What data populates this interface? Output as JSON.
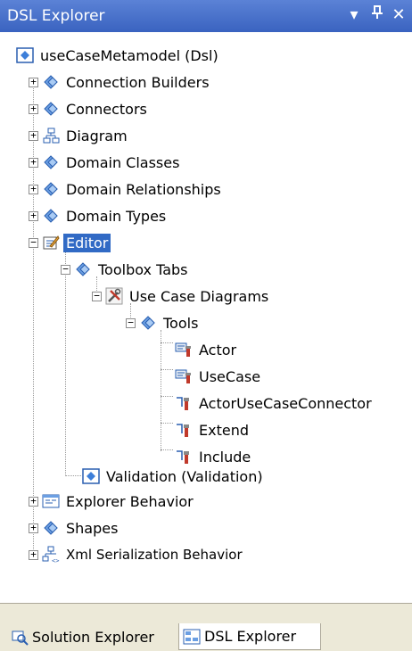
{
  "window": {
    "title": "DSL Explorer",
    "dropdown_glyph": "▾",
    "pin_glyph": "ᛡ",
    "close_glyph": "✕"
  },
  "tree": {
    "root": "useCaseMetamodel (Dsl)",
    "connection_builders": "Connection Builders",
    "connectors": "Connectors",
    "diagram": "Diagram",
    "domain_classes": "Domain Classes",
    "domain_relationships": "Domain Relationships",
    "domain_types": "Domain Types",
    "editor": "Editor",
    "toolbox_tabs": "Toolbox Tabs",
    "use_case_diagrams": "Use Case Diagrams",
    "tools": "Tools",
    "actor": "Actor",
    "usecase": "UseCase",
    "actor_usecase_connector": "ActorUseCaseConnector",
    "extend": "Extend",
    "include": "Include",
    "validation": "Validation (Validation)",
    "explorer_behavior": "Explorer Behavior",
    "shapes": "Shapes",
    "xml_serialization": "Xml Serialization Behavior"
  },
  "expander": {
    "plus": "+",
    "minus": "−"
  },
  "tabs": {
    "solution_explorer": "Solution Explorer",
    "dsl_explorer": "DSL Explorer"
  },
  "colors": {
    "selection": "#316ac5",
    "titlebar": "#3a63c0"
  }
}
